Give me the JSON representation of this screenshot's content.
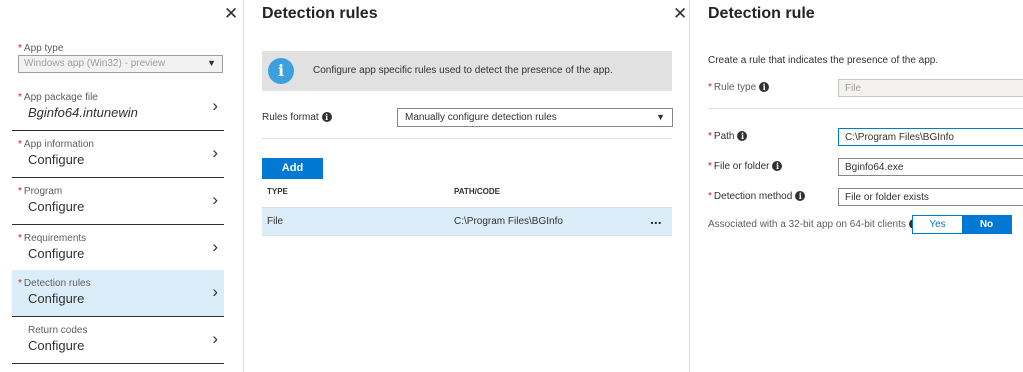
{
  "blade1": {
    "close_glyph": "✕",
    "app_type": {
      "label": "App type",
      "value": "Windows app (Win32) - preview"
    },
    "steps": [
      {
        "label": "App package file",
        "value": "Bginfo64.intunewin"
      },
      {
        "label": "App information",
        "value": "Configure"
      },
      {
        "label": "Program",
        "value": "Configure"
      },
      {
        "label": "Requirements",
        "value": "Configure"
      },
      {
        "label": "Detection rules",
        "value": "Configure"
      },
      {
        "label": "Return codes",
        "value": "Configure"
      }
    ]
  },
  "blade2": {
    "title": "Detection rules",
    "close_glyph": "✕",
    "banner_text": "Configure app specific rules used to detect the presence of the app.",
    "rules_format_label": "Rules format",
    "rules_format_value": "Manually configure detection rules",
    "add_label": "Add",
    "columns": [
      "TYPE",
      "PATH/CODE"
    ],
    "rows": [
      {
        "type": "File",
        "path": "C:\\Program Files\\BGInfo",
        "more": "..."
      }
    ]
  },
  "blade3": {
    "title": "Detection rule",
    "description": "Create a rule that indicates the presence of the app.",
    "rule_type_label": "Rule type",
    "rule_type_value": "File",
    "path_label": "Path",
    "path_value": "C:\\Program Files\\BGInfo",
    "file_label": "File or folder",
    "file_value": "Bginfo64.exe",
    "method_label": "Detection method",
    "method_value": "File or folder exists",
    "assoc_label": "Associated with a 32-bit app on 64-bit clients",
    "toggle_yes": "Yes",
    "toggle_no": "No",
    "toggle_selected": "No"
  },
  "colors": {
    "accent": "#0078d4",
    "selected_bg": "#dbedf8",
    "required": "#e81123",
    "info_icon": "#3aa0de"
  }
}
